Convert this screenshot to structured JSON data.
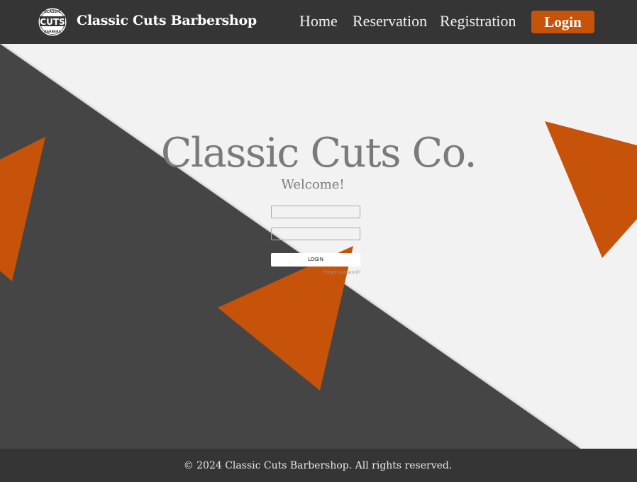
{
  "navbar": {
    "logo": {
      "icon": "barbershop-badge-logo",
      "top_text": "CLASSIC",
      "main_text": "CUTS",
      "bottom_text": "BARBERS"
    },
    "brand": "Classic Cuts Barbershop",
    "links": {
      "home": "Home",
      "reservation": "Reservation",
      "registration": "Registration"
    },
    "login_button": "Login"
  },
  "hero": {
    "title": "Classic Cuts Co.",
    "subtitle": "Welcome!"
  },
  "login_form": {
    "username_placeholder": "",
    "password_placeholder": "",
    "submit_label": "LOGIN",
    "forgot_label": "Forgot password?"
  },
  "footer": {
    "text": "© 2024 Classic Cuts Barbershop. All rights reserved."
  },
  "colors": {
    "navbar_bg": "#353535",
    "accent": "#c75209",
    "page_bg": "#f2f2f2",
    "dark_panel": "#454545",
    "title_gray": "#7a7a7a"
  }
}
